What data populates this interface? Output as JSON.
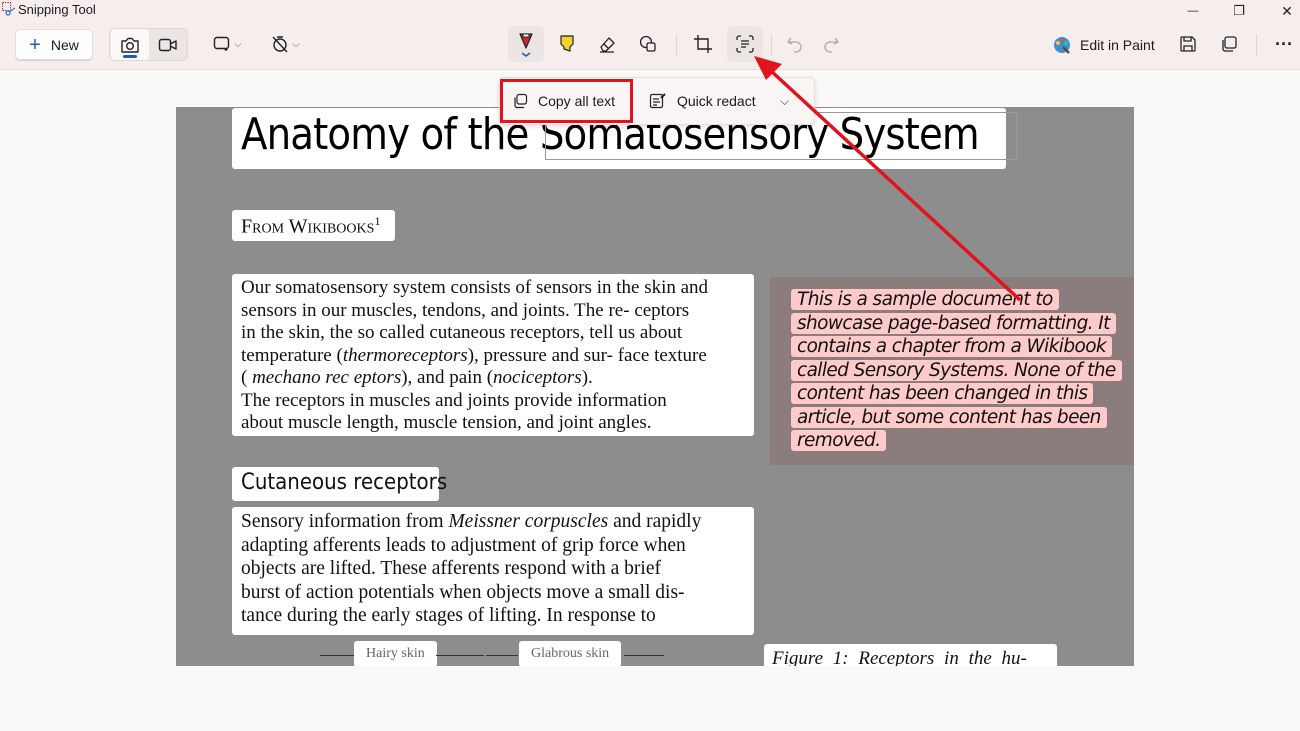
{
  "window": {
    "title": "Snipping Tool",
    "controls": {
      "minimize": "—",
      "restore": "❐",
      "close": "✕"
    }
  },
  "toolbar": {
    "new_label": "New",
    "modes": [
      {
        "name": "screenshot",
        "icon": "camera-icon",
        "active": true
      },
      {
        "name": "recording",
        "icon": "video-icon",
        "active": false
      }
    ],
    "snip_shape_icon": "rectangle-snip-icon",
    "delay_icon": "no-delay-timer-icon",
    "tools": [
      {
        "name": "ballpoint-pen",
        "icon": "pen-icon",
        "color": "#d3262b",
        "selected": true
      },
      {
        "name": "highlighter",
        "icon": "highlighter-icon",
        "color": "#f3d22c"
      },
      {
        "name": "eraser",
        "icon": "eraser-icon"
      },
      {
        "name": "shapes",
        "icon": "shapes-icon"
      },
      {
        "name": "crop",
        "icon": "crop-icon"
      },
      {
        "name": "text-actions",
        "icon": "text-actions-icon",
        "selected": true
      },
      {
        "name": "undo",
        "icon": "undo-icon",
        "disabled": true
      },
      {
        "name": "redo",
        "icon": "redo-icon",
        "disabled": true
      }
    ],
    "edit_in_paint_label": "Edit in Paint",
    "save_icon": "save-icon",
    "copy_icon": "copy-icon",
    "more_icon": "more-icon"
  },
  "text_actions_popup": {
    "copy_all_text_label": "Copy all text",
    "quick_redact_label": "Quick redact",
    "expand_icon": "chevron-down-icon"
  },
  "document": {
    "title": "Anatomy of the Somatosensory System",
    "subtitle": "From Wikibooks",
    "subtitle_sup": "1",
    "paragraph1_lines": [
      "Our somatosensory system consists of  sensors in the skin  and",
      "sensors in our  muscles, tendons, and  joints. The re- ceptors",
      "in the skin, the so  called cutaneous receptors,  tell  us about",
      "temperature (|thermoreceptors|),  pressure and sur- face  texture",
      "(  |mechano  rec  eptors|), and  pain  (|nociceptors|).",
      "The  receptors  in  muscles  and  joints  provide  information",
      "about muscle length, muscle   tension, and joint angles."
    ],
    "heading2": "Cutaneous receptors",
    "paragraph2_lines": [
      "Sensory information from |Meissner corpuscles| and rapidly",
      "adapting afferents leads to adjustment of grip force when",
      "objects  are  lifted.  These  afferents  respond  with  a  brief",
      "burst of action potentials when objects move a small dis-",
      "tance  during  the  early  stages  of  lifting.  In  response  to"
    ],
    "note_lines": [
      "This is a sample document to",
      "showcase page-based formatting. It",
      "contains a chapter from a Wikibook",
      "called Sensory Systems. None of the",
      "content has been changed in this",
      "article, but some content has been",
      "removed."
    ],
    "figure_labels": [
      "Hairy skin",
      "Glabrous skin"
    ],
    "caption": "Figure 1:  Receptors in the hu-"
  },
  "colors": {
    "accent": "#1a5fb4",
    "annotation_red": "#e0141c",
    "redact_highlight": "#ffcaca",
    "canvas_gray": "#8d8d8d"
  }
}
